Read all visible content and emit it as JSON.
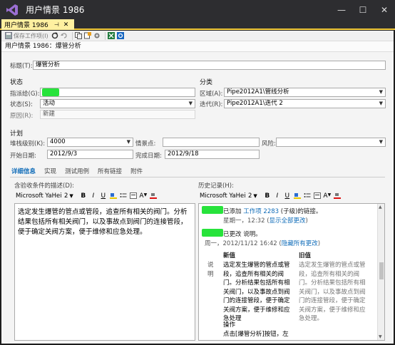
{
  "window": {
    "title": "用户情景 1986",
    "min": "—",
    "max": "☐",
    "close": "✕"
  },
  "doc_tab": {
    "label": "用户情景 1986",
    "pin": "⊣",
    "close": "✕"
  },
  "toolbar": {
    "save_label": "保存工作项(I)"
  },
  "header": {
    "title": "用户情景 1986：爆管分析"
  },
  "form": {
    "title_label": "标题(T):",
    "title_value": "爆管分析",
    "status_section": "状态",
    "class_section": "分类",
    "assigned_label": "指派给(G):",
    "state_label": "状态(S):",
    "state_value": "活动",
    "reason_label": "原因(R):",
    "reason_value": "新建",
    "area_label": "区域(A):",
    "area_value": "Pipe2012A1\\管线分析",
    "iteration_label": "迭代(R):",
    "iteration_value": "Pipe2012A1\\迭代 2",
    "plan_section": "计划",
    "stack_label": "堆栈级别(K):",
    "stack_value": "4000",
    "story_label": "情景点:",
    "story_value": "",
    "risk_label": "风险:",
    "risk_value": "",
    "start_label": "开始日期:",
    "start_value": "2012/9/3",
    "finish_label": "完成日期:",
    "finish_value": "2012/9/18"
  },
  "detail_tabs": [
    "详细信息",
    "实现",
    "测试用例",
    "所有链接",
    "附件"
  ],
  "description": {
    "label": "含验收条件的描述(D):",
    "font": "Microsoft YaHei l",
    "size": "2",
    "text": "选定发生爆管的管点或管段，追查所有相关的阀门。分析结果包括所有相关阀门，以及事故点到阀门的连接管段，便于确定关阀方案，便于维修和应急处理。"
  },
  "history": {
    "label": "历史记录(H):",
    "font": "Microsoft YaHei l",
    "size": "2",
    "e1_text": "已添加 ",
    "e1_link": "工作项 2283",
    "e1_rest": " (子级)的链接。",
    "e1_date": "星期一，12:32 (",
    "e1_show": "显示全部更改",
    "e1_close": ")",
    "e2_text": "已更改 说明。",
    "e2_date": "周一，2012/11/12 16:42 (",
    "e2_hide": "隐藏所有更改",
    "e2_close": ")",
    "new_header": "新值",
    "old_header": "旧值",
    "row_label": "说明",
    "new_value": "选定发生爆管的管点或管段，追查所有相关的阀门。分析结果包括所有相关阀门，以及事故点到阀门的连接管段，便于确定关阀方案，便于维修和应急处理",
    "old_value": "选定发生爆管的管点或管段，追查所有相关的阀门。分析结果包括所有相关阀门，以及事故点到阀门的连接管段，便于确定关阀方案，便于维修和应急处理。",
    "extra1": "操作",
    "extra2": "点击[爆管分析]按钮，左"
  },
  "colors": {
    "accent": "#0e6bb8",
    "tab_bg": "#fff0a0",
    "redacted": "#27e33b"
  }
}
